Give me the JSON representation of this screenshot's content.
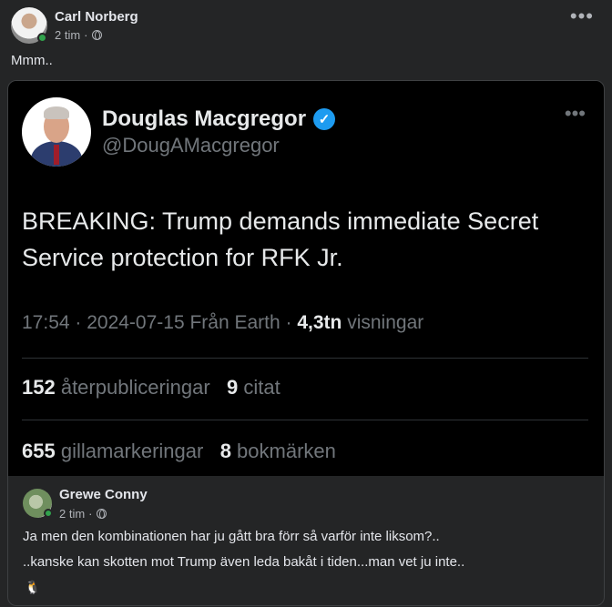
{
  "post": {
    "author": "Carl Norberg",
    "time": "2 tim",
    "text": "Mmm.."
  },
  "tweet": {
    "name": "Douglas Macgregor",
    "handle": "@DougAMacgregor",
    "body": "BREAKING: Trump demands immediate Secret Service protection for RFK Jr.",
    "meta_prefix": "17:54 · 2024-07-15 Från Earth · ",
    "views_count": "4,3tn",
    "views_label": " visningar",
    "reposts_count": "152",
    "reposts_label": " återpubliceringar",
    "quotes_count": "9",
    "quotes_label": " citat",
    "likes_count": "655",
    "likes_label": " gillamarkeringar",
    "bookmarks_count": "8",
    "bookmarks_label": " bokmärken"
  },
  "comment": {
    "author": "Grewe Conny",
    "time": "2 tim",
    "line1": "Ja men den kombinationen har ju gått bra förr så varför inte liksom?..",
    "line2": "..kanske kan skotten mot Trump även leda bakåt i tiden...man vet ju inte..",
    "emoji": "🐧"
  },
  "icons": {
    "privacy": "globe-icon",
    "verified": "verified-badge-icon",
    "more": "more-options-icon"
  },
  "colors": {
    "background": "#242526",
    "tweet_bg": "#000000",
    "verified": "#1d9bf0",
    "online": "#31a24c"
  }
}
